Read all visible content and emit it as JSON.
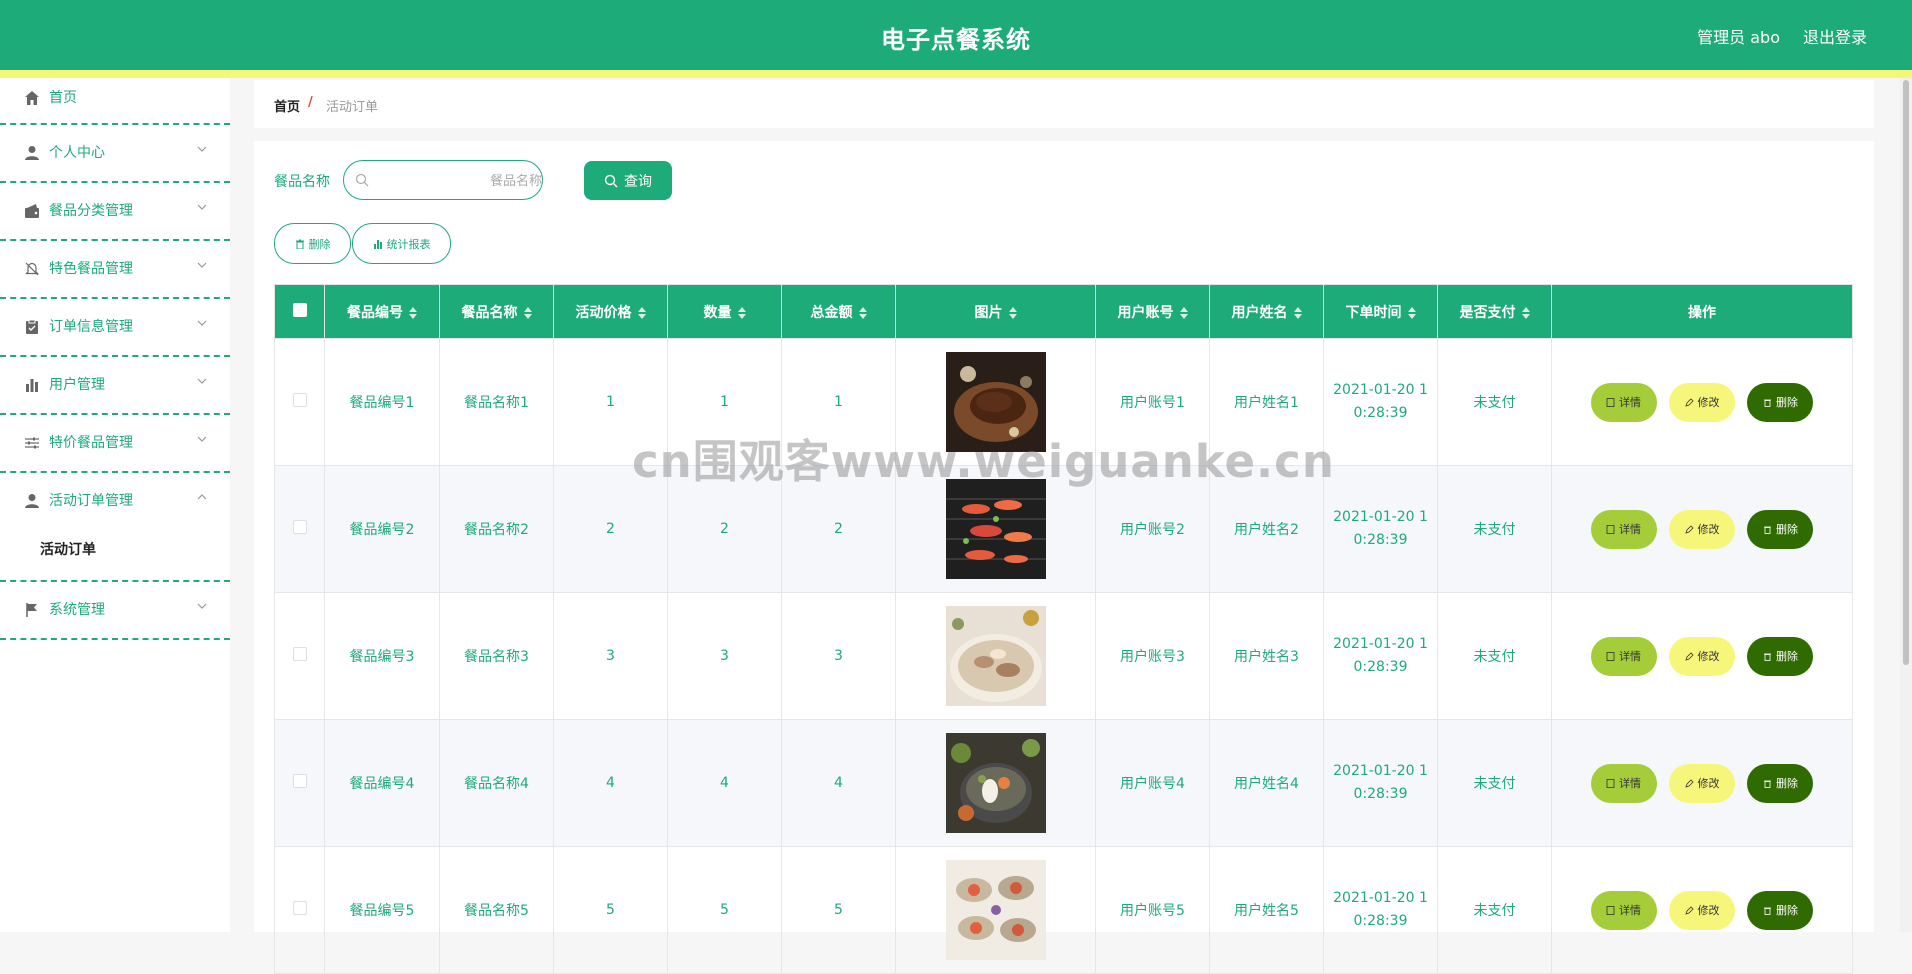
{
  "header": {
    "title": "电子点餐系统",
    "user": "管理员 abo",
    "logout": "退出登录"
  },
  "sidebar": {
    "items": [
      {
        "label": "首页",
        "icon": "home-icon"
      },
      {
        "label": "个人中心",
        "icon": "user-icon"
      },
      {
        "label": "餐品分类管理",
        "icon": "wallet-icon"
      },
      {
        "label": "特色餐品管理",
        "icon": "bell-off-icon"
      },
      {
        "label": "订单信息管理",
        "icon": "clipboard-icon"
      },
      {
        "label": "用户管理",
        "icon": "bar-chart-icon"
      },
      {
        "label": "特价餐品管理",
        "icon": "sliders-icon"
      },
      {
        "label": "活动订单管理",
        "icon": "user-icon",
        "sub": "活动订单"
      },
      {
        "label": "系统管理",
        "icon": "flag-icon"
      }
    ]
  },
  "breadcrumb": {
    "home": "首页",
    "sep": "/",
    "current": "活动订单"
  },
  "search": {
    "label": "餐品名称",
    "placeholder": "餐品名称",
    "button": "查询"
  },
  "actions": {
    "delete": "删除",
    "stats": "统计报表"
  },
  "table": {
    "columns": [
      "餐品编号",
      "餐品名称",
      "活动价格",
      "数量",
      "总金额",
      "图片",
      "用户账号",
      "用户姓名",
      "下单时间",
      "是否支付",
      "操作"
    ],
    "rows": [
      {
        "code": "餐品编号1",
        "name": "餐品名称1",
        "price": "1",
        "qty": "1",
        "total": "1",
        "account": "用户账号1",
        "uname": "用户姓名1",
        "time1": "2021-01-20 1",
        "time2": "0:28:39",
        "paid": "未支付"
      },
      {
        "code": "餐品编号2",
        "name": "餐品名称2",
        "price": "2",
        "qty": "2",
        "total": "2",
        "account": "用户账号2",
        "uname": "用户姓名2",
        "time1": "2021-01-20 1",
        "time2": "0:28:39",
        "paid": "未支付"
      },
      {
        "code": "餐品编号3",
        "name": "餐品名称3",
        "price": "3",
        "qty": "3",
        "total": "3",
        "account": "用户账号3",
        "uname": "用户姓名3",
        "time1": "2021-01-20 1",
        "time2": "0:28:39",
        "paid": "未支付"
      },
      {
        "code": "餐品编号4",
        "name": "餐品名称4",
        "price": "4",
        "qty": "4",
        "total": "4",
        "account": "用户账号4",
        "uname": "用户姓名4",
        "time1": "2021-01-20 1",
        "time2": "0:28:39",
        "paid": "未支付"
      },
      {
        "code": "餐品编号5",
        "name": "餐品名称5",
        "price": "5",
        "qty": "5",
        "total": "5",
        "account": "用户账号5",
        "uname": "用户姓名5",
        "time1": "2021-01-20 1",
        "time2": "0:28:39",
        "paid": "未支付"
      }
    ],
    "row_actions": {
      "detail": "详情",
      "edit": "修改",
      "delete": "删除"
    }
  },
  "watermark": "cn围观客www.weiguanke.cn",
  "colors": {
    "primary": "#1dab79",
    "accent_yellow": "#f6f77a",
    "detail_btn": "#a4cd39",
    "delete_btn": "#2f6b00"
  }
}
